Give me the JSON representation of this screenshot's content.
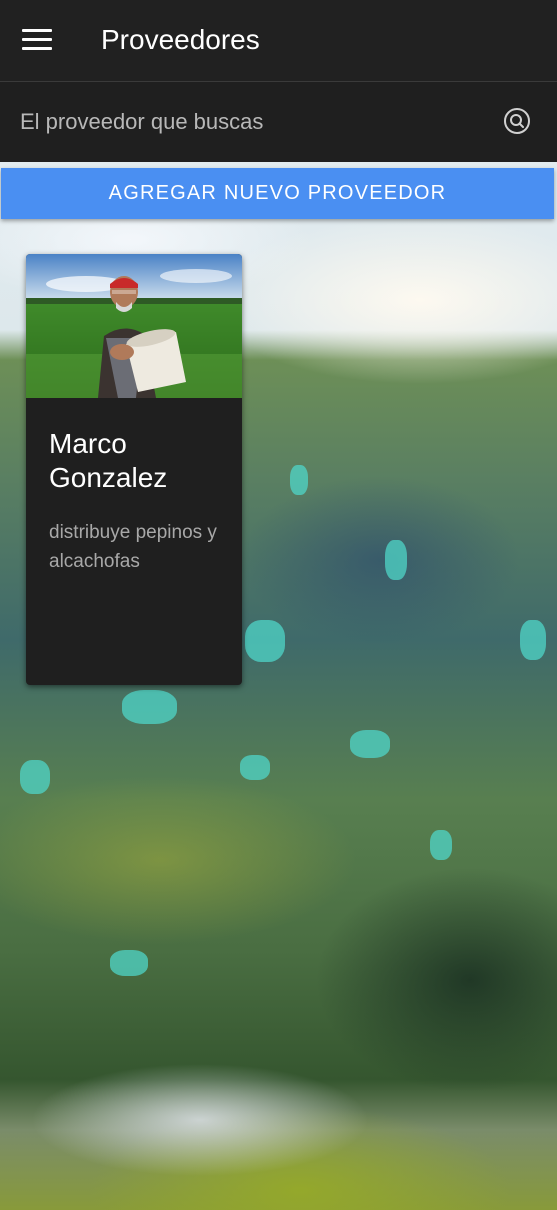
{
  "app": {
    "title": "Proveedores"
  },
  "icons": {
    "menu": "menu-icon",
    "search": "search-icon"
  },
  "search": {
    "placeholder": "El proveedor que buscas",
    "value": ""
  },
  "actions": {
    "add_label": "AGREGAR NUEVO PROVEEDOR"
  },
  "providers": [
    {
      "name": "Marco Gonzalez",
      "description": "distribuye pepinos y alcachofas",
      "photo": "farmer-photo"
    }
  ],
  "colors": {
    "appbar": "#212121",
    "accent": "#4a8ff2",
    "card": "#1f1f1f"
  }
}
